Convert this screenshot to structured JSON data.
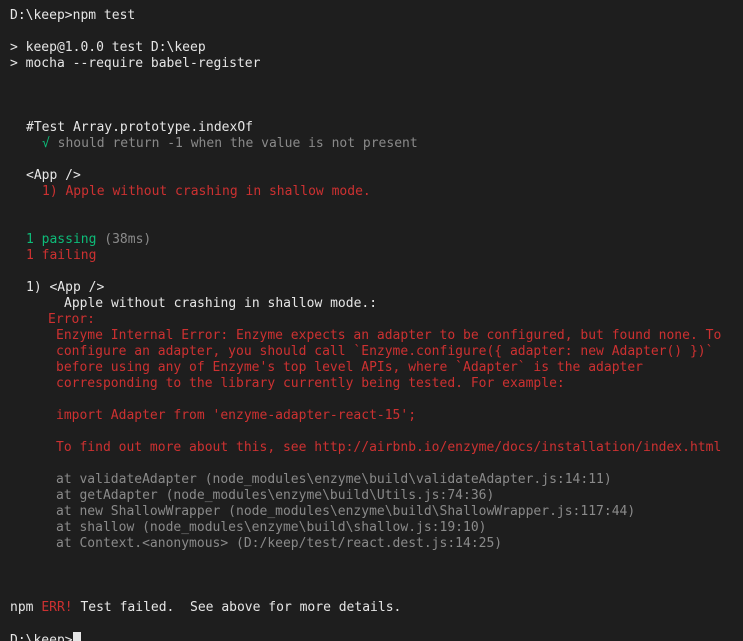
{
  "prompt_1": "D:\\keep>",
  "command": "npm test",
  "npm_script_line1": "> keep@1.0.0 test D:\\keep",
  "npm_script_line2": "> mocha --require babel-register",
  "suite1_title": "#Test Array.prototype.indexOf",
  "suite1_check": "√",
  "suite1_test": " should return -1 when the value is not present",
  "suite2_title": "<App />",
  "suite2_fail": "1) Apple without crashing in shallow mode.",
  "passing_label": "1 passing",
  "passing_duration": " (38ms)",
  "failing_label": "1 failing",
  "fail_header": "1) <App />",
  "fail_subtitle": "Apple without crashing in shallow mode.:",
  "error_label": "Error:",
  "error_message": [
    "Enzyme Internal Error: Enzyme expects an adapter to be configured, but found none. To",
    "configure an adapter, you should call `Enzyme.configure({ adapter: new Adapter() })`",
    "before using any of Enzyme's top level APIs, where `Adapter` is the adapter",
    "corresponding to the library currently being tested. For example:"
  ],
  "error_example": "import Adapter from 'enzyme-adapter-react-15';",
  "error_more_info": "To find out more about this, see http://airbnb.io/enzyme/docs/installation/index.html",
  "stack_trace": [
    "at validateAdapter (node_modules\\enzyme\\build\\validateAdapter.js:14:11)",
    "at getAdapter (node_modules\\enzyme\\build\\Utils.js:74:36)",
    "at new ShallowWrapper (node_modules\\enzyme\\build\\ShallowWrapper.js:117:44)",
    "at shallow (node_modules\\enzyme\\build\\shallow.js:19:10)",
    "at Context.<anonymous> (D:/keep/test/react.dest.js:14:25)"
  ],
  "npm_prefix": "npm ",
  "npm_err": "ERR!",
  "npm_err_message": " Test failed.  See above for more details.",
  "prompt_2": "D:\\keep>",
  "colors": {
    "background": "#1e1e1e",
    "text": "#e6e6e6",
    "dim": "#8a8a8a",
    "pass": "#0dbc79",
    "fail": "#cd3131"
  }
}
